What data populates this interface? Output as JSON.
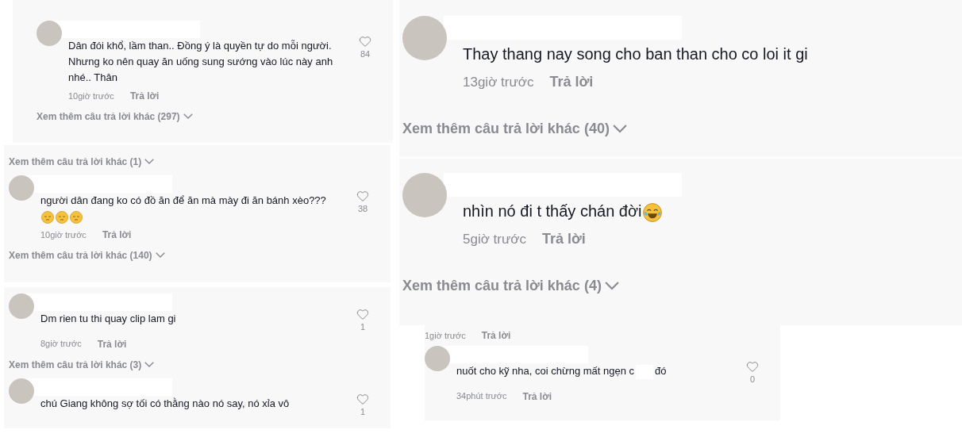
{
  "left_column": [
    {
      "items": [
        {
          "kind": "comment",
          "text": "Dân đói khổ, lầm than.. Đồng ý là quyền tự do mỗi người. Nhưng ko nên quay ăn uống sung sướng vào lúc này anh nhé.. Thân",
          "likes": "84",
          "time": "10giờ trước",
          "reply": "Trả lời"
        },
        {
          "kind": "more_replies",
          "text": "Xem thêm câu trả lời khác (297)"
        }
      ]
    },
    {
      "items": [
        {
          "kind": "more_replies",
          "text": "Xem thêm câu trả lời khác (1)"
        },
        {
          "kind": "comment",
          "text": "người dân đang ko có đồ ăn để ăn mà mày đi ăn bánh xèo???",
          "emojis": [
            {
              "kind": "pensive"
            },
            {
              "kind": "pensive"
            },
            {
              "kind": "pensive"
            }
          ],
          "likes": "38",
          "time": "10giờ trước",
          "reply": "Trả lời"
        },
        {
          "kind": "more_replies",
          "text": "Xem thêm câu trả lời khác (140)"
        }
      ]
    },
    {
      "items": [
        {
          "kind": "comment",
          "text": "Dm rien tu thi quay clip lam gi",
          "likes": "1",
          "time": "8giờ trước",
          "reply": "Trả lời"
        },
        {
          "kind": "more_replies",
          "text": "Xem thêm câu trả lời khác (3)"
        },
        {
          "kind": "comment",
          "text": "chú Giang không sợ tối có thằng nào nó say, nó xỉa vô",
          "likes": "1"
        }
      ]
    }
  ],
  "right_column": [
    {
      "items": [
        {
          "kind": "comment",
          "text": "Thay thang nay song cho ban than cho co loi it gi",
          "time": "13giờ trước",
          "reply": "Trả lời"
        },
        {
          "kind": "more_replies",
          "text": "Xem thêm câu trả lời khác (40)"
        }
      ]
    },
    {
      "items": [
        {
          "kind": "comment",
          "text": "nhìn nó đi t thấy chán đời",
          "emojis": [
            {
              "kind": "tears-of-joy"
            }
          ],
          "time": "5giờ trước",
          "reply": "Trả lời"
        },
        {
          "kind": "more_replies",
          "text": "Xem thêm câu trả lời khác (4)"
        }
      ]
    }
  ],
  "bottom_right_panel": {
    "items": [
      {
        "kind": "meta",
        "time": "1giờ trước",
        "reply": "Trả lời"
      },
      {
        "kind": "comment",
        "text": "nuốt cho kỹ nha, coi chừng mất ngẹn c",
        "text_after": "đó",
        "likes": "0",
        "time": "34phút trước",
        "reply": "Trả lời"
      }
    ]
  }
}
